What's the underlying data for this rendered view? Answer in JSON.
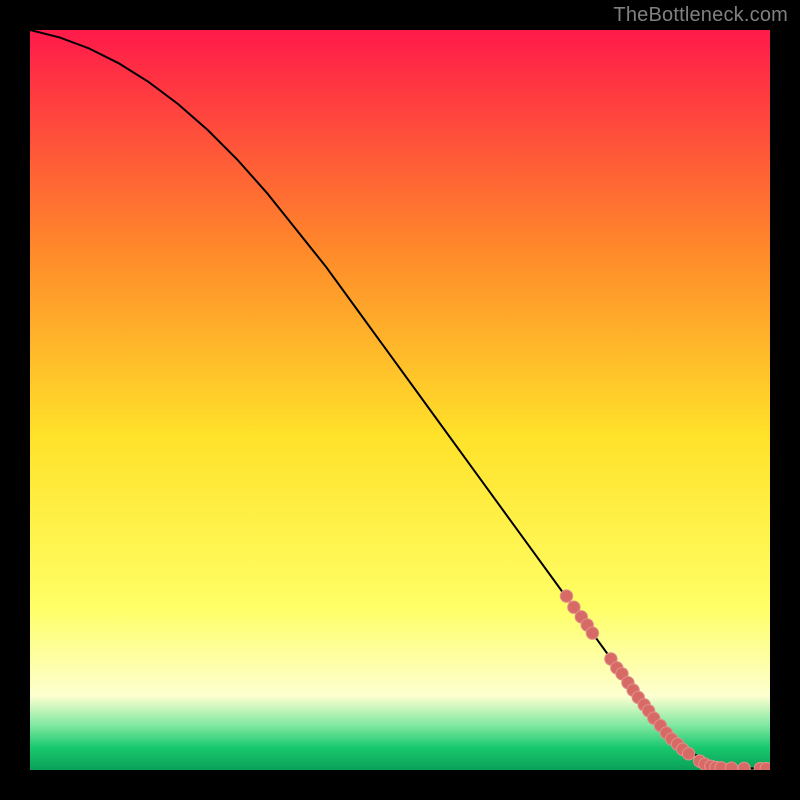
{
  "watermark": "TheBottleneck.com",
  "colors": {
    "bg": "#000000",
    "curve": "#000000",
    "dot_fill": "#d86a66",
    "dot_stroke": "#e08f8c",
    "grad_top": "#ff1a4a",
    "grad_mid1": "#ff8a2a",
    "grad_mid2": "#ffe22a",
    "grad_mid3": "#ffff66",
    "grad_mid4": "#fdffd0",
    "grad_green1": "#7fe8a0",
    "grad_green2": "#18c86e",
    "grad_bottom": "#0aa058"
  },
  "chart_data": {
    "type": "line",
    "title": "",
    "xlabel": "",
    "ylabel": "",
    "xlim": [
      0,
      100
    ],
    "ylim": [
      0,
      100
    ],
    "series": [
      {
        "name": "curve",
        "x": [
          0,
          4,
          8,
          12,
          16,
          20,
          24,
          28,
          32,
          36,
          40,
          44,
          48,
          52,
          56,
          60,
          64,
          68,
          72,
          76,
          80,
          82,
          85,
          88,
          90,
          92,
          94,
          96,
          98,
          100
        ],
        "y": [
          100,
          99,
          97.5,
          95.5,
          93,
          90,
          86.5,
          82.5,
          78,
          73,
          68,
          62.5,
          57,
          51.5,
          46,
          40.5,
          35,
          29.5,
          24,
          18.5,
          13,
          10,
          6.5,
          3.5,
          2,
          1,
          0.5,
          0.3,
          0.2,
          0.2
        ]
      }
    ],
    "highlight_dots": {
      "name": "dots",
      "points": [
        {
          "x": 72.5,
          "y": 23.5
        },
        {
          "x": 73.5,
          "y": 22.0
        },
        {
          "x": 74.5,
          "y": 20.7
        },
        {
          "x": 75.3,
          "y": 19.6
        },
        {
          "x": 76.0,
          "y": 18.5
        },
        {
          "x": 78.5,
          "y": 15.0
        },
        {
          "x": 79.3,
          "y": 13.8
        },
        {
          "x": 80.0,
          "y": 13.0
        },
        {
          "x": 80.8,
          "y": 11.8
        },
        {
          "x": 81.5,
          "y": 10.8
        },
        {
          "x": 82.2,
          "y": 9.8
        },
        {
          "x": 83.0,
          "y": 8.8
        },
        {
          "x": 83.6,
          "y": 8.0
        },
        {
          "x": 84.3,
          "y": 7.0
        },
        {
          "x": 85.2,
          "y": 6.0
        },
        {
          "x": 86.0,
          "y": 5.0
        },
        {
          "x": 86.7,
          "y": 4.2
        },
        {
          "x": 87.5,
          "y": 3.5
        },
        {
          "x": 88.2,
          "y": 2.8
        },
        {
          "x": 89.0,
          "y": 2.2
        },
        {
          "x": 90.5,
          "y": 1.2
        },
        {
          "x": 91.2,
          "y": 0.8
        },
        {
          "x": 92.0,
          "y": 0.5
        },
        {
          "x": 92.7,
          "y": 0.35
        },
        {
          "x": 93.4,
          "y": 0.3
        },
        {
          "x": 94.8,
          "y": 0.25
        },
        {
          "x": 96.5,
          "y": 0.22
        },
        {
          "x": 98.7,
          "y": 0.2
        },
        {
          "x": 99.5,
          "y": 0.2
        }
      ]
    }
  }
}
